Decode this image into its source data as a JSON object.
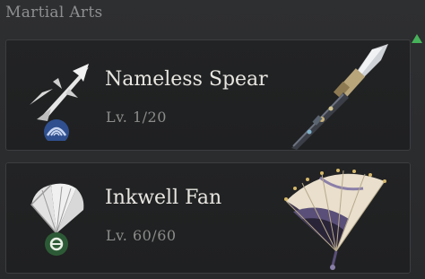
{
  "section": {
    "title": "Martial Arts"
  },
  "martial_arts": [
    {
      "name": "Nameless Spear",
      "level": "Lv. 1/20",
      "icon": "spear-skill-icon",
      "art": "spear-weapon-art"
    },
    {
      "name": "Inkwell Fan",
      "level": "Lv. 60/60",
      "icon": "fan-skill-icon",
      "art": "fan-weapon-art"
    }
  ],
  "colors": {
    "scroll_indicator": "#46b25a",
    "badge_blue": "#2f4f8e",
    "badge_green": "#2d5a36",
    "card_bg": "#202122"
  }
}
